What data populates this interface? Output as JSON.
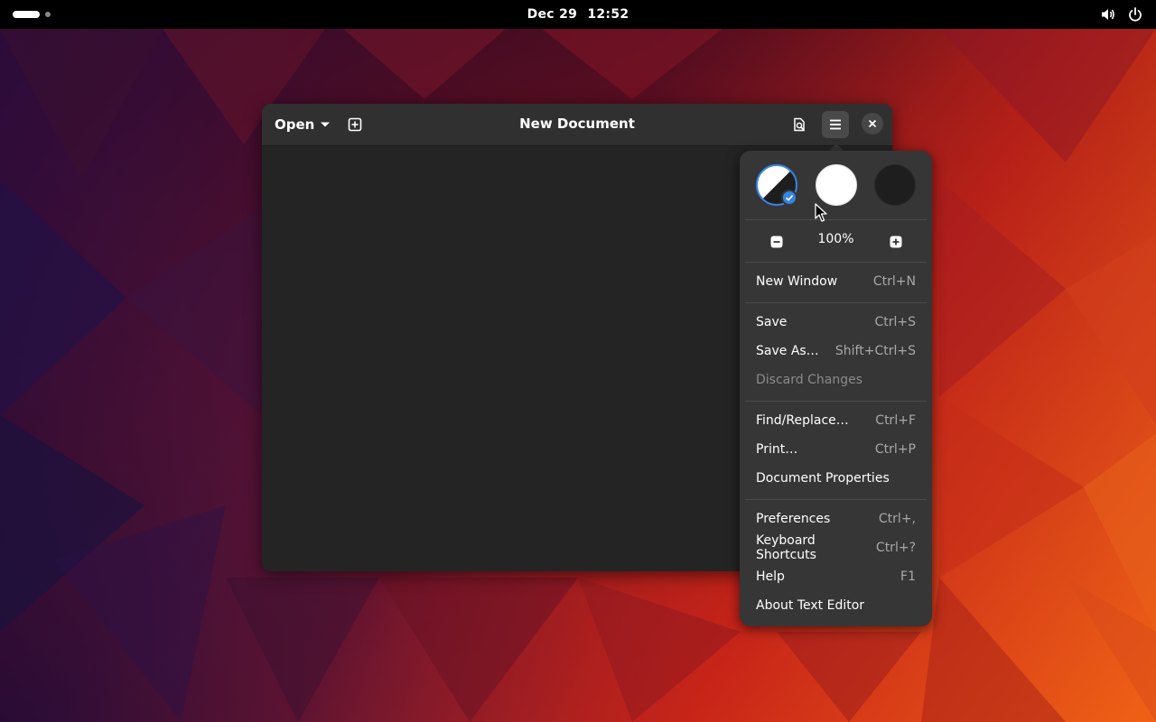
{
  "topbar": {
    "date": "Dec 29",
    "time": "12:52",
    "tray_icons": [
      "volume-icon",
      "power-icon"
    ]
  },
  "window": {
    "title": "New Document",
    "open_label": "Open",
    "icons": [
      "chevron-down-icon",
      "new-tab-icon",
      "find-file-icon",
      "hamburger-menu-icon",
      "close-icon"
    ]
  },
  "menu": {
    "style_options": [
      "follow-system-style",
      "light-style",
      "dark-style"
    ],
    "selected_style": "follow-system-style",
    "zoom": "100%",
    "sections": [
      [
        {
          "label": "New Window",
          "accel": "Ctrl+N",
          "enabled": true
        }
      ],
      [
        {
          "label": "Save",
          "accel": "Ctrl+S",
          "enabled": true
        },
        {
          "label": "Save As…",
          "accel": "Shift+Ctrl+S",
          "enabled": true
        },
        {
          "label": "Discard Changes",
          "accel": "",
          "enabled": false
        }
      ],
      [
        {
          "label": "Find/Replace…",
          "accel": "Ctrl+F",
          "enabled": true
        },
        {
          "label": "Print…",
          "accel": "Ctrl+P",
          "enabled": true
        },
        {
          "label": "Document Properties",
          "accel": "",
          "enabled": true
        }
      ],
      [
        {
          "label": "Preferences",
          "accel": "Ctrl+,",
          "enabled": true
        },
        {
          "label": "Keyboard Shortcuts",
          "accel": "Ctrl+?",
          "enabled": true
        },
        {
          "label": "Help",
          "accel": "F1",
          "enabled": true
        },
        {
          "label": "About Text Editor",
          "accel": "",
          "enabled": true
        }
      ]
    ]
  },
  "colors": {
    "accent": "#3584e4",
    "window_bg": "#242424",
    "headerbar_bg": "#303030",
    "popover_bg": "#363636"
  }
}
